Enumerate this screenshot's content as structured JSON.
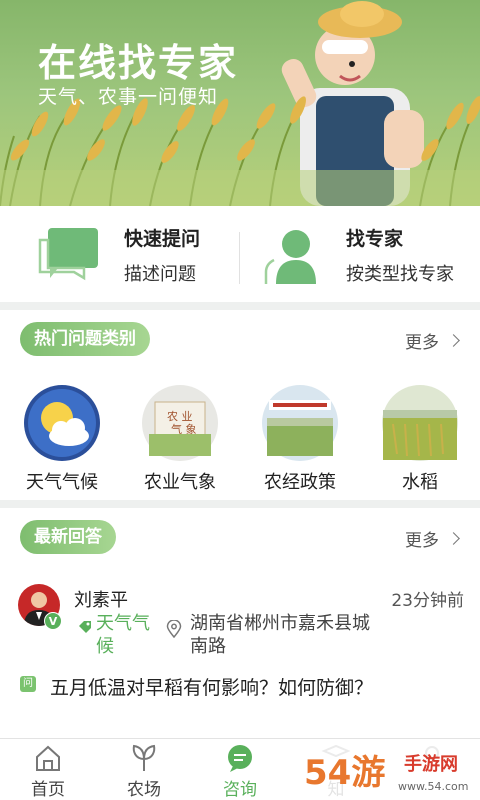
{
  "banner": {
    "title": "在线找专家",
    "subtitle": "天气、农事一问便知"
  },
  "quick_actions": [
    {
      "title": "快速提问",
      "desc": "描述问题",
      "icon": "chat-bubble-icon"
    },
    {
      "title": "找专家",
      "desc": "按类型找专家",
      "icon": "expert-person-icon"
    }
  ],
  "hot_categories": {
    "title": "热门问题类别",
    "more_label": "更多",
    "items": [
      {
        "label": "天气气候",
        "image": "weather-sun-cloud"
      },
      {
        "label": "农业气象",
        "image": "agri-meteorology-sign"
      },
      {
        "label": "农经政策",
        "image": "agri-policy-field"
      },
      {
        "label": "水稻",
        "image": "rice-field"
      }
    ]
  },
  "latest_answers": {
    "title": "最新回答",
    "more_label": "更多",
    "item": {
      "name": "刘素平",
      "badge": "V",
      "time": "23分钟前",
      "tag": "天气气候",
      "location": "湖南省郴州市嘉禾县城南路",
      "question_badge": "问",
      "question": "五月低温对早稻有何影响？如何防御？"
    }
  },
  "bottom_nav": [
    {
      "label": "首页",
      "icon": "home-icon",
      "active": false
    },
    {
      "label": "农场",
      "icon": "leaf-sprout-icon",
      "active": false
    },
    {
      "label": "咨询",
      "icon": "chat-icon",
      "active": true
    },
    {
      "label": "知",
      "icon": "book-icon",
      "active": false
    },
    {
      "label": "",
      "icon": "profile-icon",
      "active": false
    }
  ],
  "watermark": {
    "brand": "54游",
    "site": "手游网",
    "url": "www.54.com"
  },
  "colors": {
    "accent_green": "#59b05b",
    "pill_green": "#7ebd6f",
    "banner_green": "#86b66a"
  }
}
